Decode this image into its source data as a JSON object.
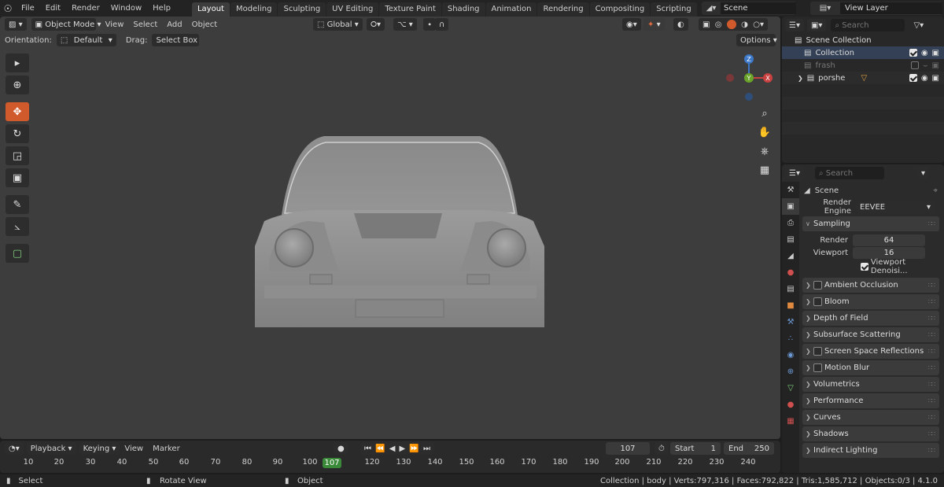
{
  "menu": {
    "items": [
      "File",
      "Edit",
      "Render",
      "Window",
      "Help"
    ]
  },
  "workspaces": {
    "tabs": [
      "Layout",
      "Modeling",
      "Sculpting",
      "UV Editing",
      "Texture Paint",
      "Shading",
      "Animation",
      "Rendering",
      "Compositing",
      "Scripting"
    ],
    "active": "Layout",
    "add": "+"
  },
  "scene": {
    "name": "Scene"
  },
  "view_layer": {
    "name": "View Layer"
  },
  "viewport": {
    "mode": "Object Mode",
    "menus": [
      "View",
      "Select",
      "Add",
      "Object"
    ],
    "transform_orientation": "Global",
    "orientation_label": "Orientation:",
    "orientation_value": "Default",
    "drag_label": "Drag:",
    "drag_value": "Select Box",
    "options": "Options",
    "gizmo": {
      "x": "X",
      "y": "Y",
      "z": "Z"
    }
  },
  "timeline": {
    "menus": [
      "Playback",
      "Keying",
      "View",
      "Marker"
    ],
    "current_frame": "107",
    "start_label": "Start",
    "start": "1",
    "end_label": "End",
    "end": "250",
    "ticks": [
      "10",
      "20",
      "30",
      "40",
      "50",
      "60",
      "70",
      "80",
      "90",
      "100",
      "120",
      "130",
      "140",
      "150",
      "160",
      "170",
      "180",
      "190",
      "200",
      "210",
      "220",
      "230",
      "240"
    ]
  },
  "statusbar": {
    "select": "Select",
    "rotate": "Rotate View",
    "object": "Object",
    "stats": "Collection | body | Verts:797,316 | Faces:792,822 | Tris:1,585,712 | Objects:0/3 | 4.1.0"
  },
  "outliner": {
    "search_placeholder": "Search",
    "rows": [
      {
        "name": "Scene Collection",
        "indent": 0
      },
      {
        "name": "Collection",
        "indent": 1
      },
      {
        "name": "frash",
        "indent": 1
      },
      {
        "name": "porshe",
        "indent": 1
      }
    ]
  },
  "properties": {
    "search_placeholder": "Search",
    "context": "Scene",
    "render_engine_label": "Render Engine",
    "render_engine": "EEVEE",
    "sampling": {
      "title": "Sampling",
      "render_label": "Render",
      "render": "64",
      "viewport_label": "Viewport",
      "viewport": "16",
      "denoise_label": "Viewport Denoisi..."
    },
    "panels": [
      {
        "label": "Ambient Occlusion",
        "checkbox": true
      },
      {
        "label": "Bloom",
        "checkbox": true
      },
      {
        "label": "Depth of Field",
        "checkbox": false
      },
      {
        "label": "Subsurface Scattering",
        "checkbox": false
      },
      {
        "label": "Screen Space Reflections",
        "checkbox": true
      },
      {
        "label": "Motion Blur",
        "checkbox": true
      },
      {
        "label": "Volumetrics",
        "checkbox": false
      },
      {
        "label": "Performance",
        "checkbox": false
      },
      {
        "label": "Curves",
        "checkbox": false
      },
      {
        "label": "Shadows",
        "checkbox": false
      },
      {
        "label": "Indirect Lighting",
        "checkbox": false
      }
    ]
  },
  "colors": {
    "accent": "#d15a2d",
    "frame": "#3a8a3a",
    "axis_x": "#c8403f",
    "axis_y": "#6aa329",
    "axis_z": "#3d78c8"
  }
}
